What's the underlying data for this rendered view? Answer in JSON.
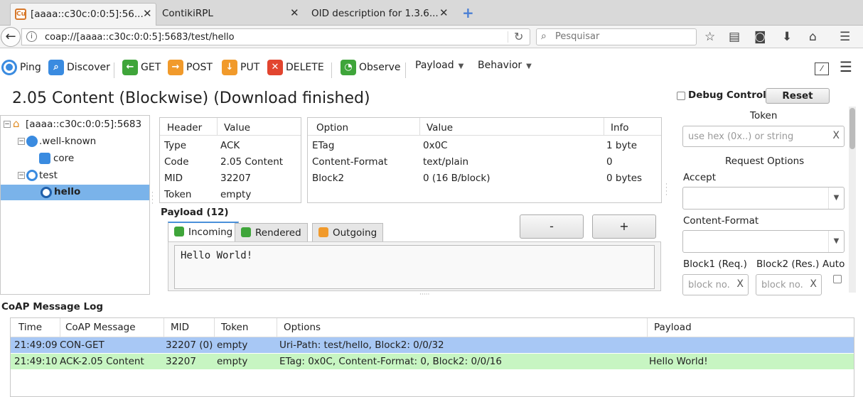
{
  "browser": {
    "tabs": [
      {
        "title": "[aaaa::c30c:0:0:5]:56..."
      },
      {
        "title": "ContikiRPL"
      },
      {
        "title": "OID description for 1.3.6..."
      }
    ],
    "url": "coap://[aaaa::c30c:0:0:5]:5683/test/hello",
    "search_placeholder": "Pesquisar"
  },
  "toolbar": {
    "ping": "Ping",
    "discover": "Discover",
    "get": "GET",
    "post": "POST",
    "put": "PUT",
    "delete": "DELETE",
    "observe": "Observe",
    "payload": "Payload",
    "behavior": "Behavior"
  },
  "status": "2.05 Content (Blockwise) (Download finished)",
  "tree": {
    "root": "[aaaa::c30c:0:0:5]:5683",
    "well_known": ".well-known",
    "core": "core",
    "test": "test",
    "hello": "hello"
  },
  "headers": {
    "columns": [
      "Header",
      "Value"
    ],
    "rows": [
      [
        "Type",
        "ACK"
      ],
      [
        "Code",
        "2.05 Content"
      ],
      [
        "MID",
        "32207"
      ],
      [
        "Token",
        "empty"
      ]
    ]
  },
  "options": {
    "columns": [
      "Option",
      "Value",
      "Info"
    ],
    "rows": [
      [
        "ETag",
        "0x0C",
        "1 byte"
      ],
      [
        "Content-Format",
        "text/plain",
        "0"
      ],
      [
        "Block2",
        "0 (16 B/block)",
        "0 bytes"
      ]
    ]
  },
  "payload": {
    "label": "Payload (12)",
    "tabs": [
      "Incoming",
      "Rendered",
      "Outgoing"
    ],
    "text": "Hello World!",
    "minus": "-",
    "plus": "+"
  },
  "right_pane": {
    "debug_control": "Debug Control",
    "reset": "Reset",
    "token_label": "Token",
    "token_placeholder": "use hex (0x..) or string",
    "request_options": "Request Options",
    "accept": "Accept",
    "content_format": "Content-Format",
    "block1": "Block1 (Req.)",
    "block2": "Block2 (Res.)",
    "auto": "Auto",
    "block_placeholder": "block no."
  },
  "log": {
    "title": "CoAP Message Log",
    "columns": [
      "Time",
      "CoAP Message",
      "MID",
      "Token",
      "Options",
      "Payload"
    ],
    "rows": [
      {
        "time": "21:49:09",
        "message": "CON-GET",
        "mid": "32207 (0)",
        "token": "empty",
        "options": "Uri-Path: test/hello, Block2: 0/0/32",
        "payload": "",
        "color": "#a8c8f5"
      },
      {
        "time": "21:49:10",
        "message": "ACK-2.05 Content",
        "mid": "32207",
        "token": "empty",
        "options": "ETag: 0x0C, Content-Format: 0, Block2: 0/0/16",
        "payload": "Hello World!",
        "color": "#c7f5c2"
      }
    ]
  },
  "colors": {
    "selection": "#7ab3ea",
    "row_request": "#a8c8f5",
    "row_response": "#c7f5c2"
  }
}
